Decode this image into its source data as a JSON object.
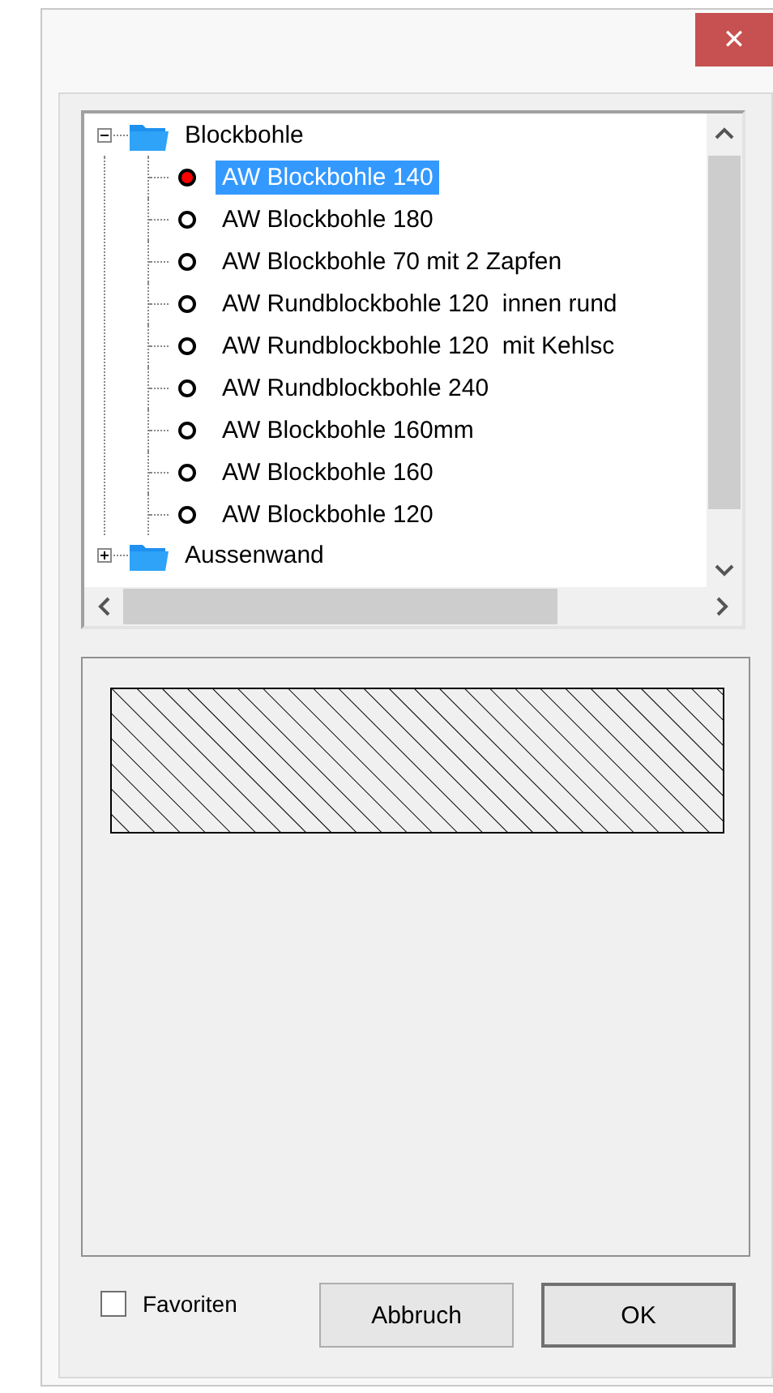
{
  "window": {
    "close_label": "✕"
  },
  "tree": [
    {
      "label": "Blockbohle",
      "expanded": true,
      "children": [
        {
          "label": "AW Blockbohle 140",
          "selected": true,
          "active": true
        },
        {
          "label": "AW Blockbohle 180",
          "selected": false,
          "active": false
        },
        {
          "label": "AW Blockbohle 70 mit 2 Zapfen",
          "selected": false,
          "active": false
        },
        {
          "label": "AW Rundblockbohle 120  innen rund",
          "selected": false,
          "active": false
        },
        {
          "label": "AW Rundblockbohle 120  mit Kehlsc",
          "selected": false,
          "active": false
        },
        {
          "label": "AW Rundblockbohle 240",
          "selected": false,
          "active": false
        },
        {
          "label": "AW Blockbohle 160mm",
          "selected": false,
          "active": false
        },
        {
          "label": "AW Blockbohle 160",
          "selected": false,
          "active": false
        },
        {
          "label": "AW Blockbohle 120",
          "selected": false,
          "active": false
        }
      ]
    },
    {
      "label": "Aussenwand",
      "expanded": false
    }
  ],
  "favorites": {
    "label": "Favoriten",
    "checked": false
  },
  "buttons": [
    {
      "label": "Abbruch",
      "default": false
    },
    {
      "label": "OK",
      "default": true
    }
  ]
}
